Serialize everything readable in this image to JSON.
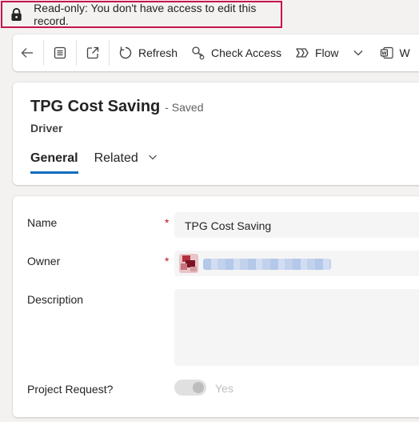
{
  "banner": {
    "text": "Read-only: You don't have access to edit this record."
  },
  "toolbar": {
    "refresh": "Refresh",
    "check_access": "Check Access",
    "flow": "Flow",
    "truncated": "W"
  },
  "record": {
    "title": "TPG Cost Saving",
    "status": "- Saved",
    "entity": "Driver"
  },
  "tabs": [
    {
      "label": "General"
    },
    {
      "label": "Related"
    }
  ],
  "form": {
    "name_label": "Name",
    "name_value": "TPG Cost Saving",
    "owner_label": "Owner",
    "description_label": "Description",
    "project_request_label": "Project Request?",
    "project_request_value": "Yes"
  },
  "colors": {
    "accent": "#0f6cbd",
    "banner_border": "#c7144c",
    "required": "#c50f1f"
  }
}
